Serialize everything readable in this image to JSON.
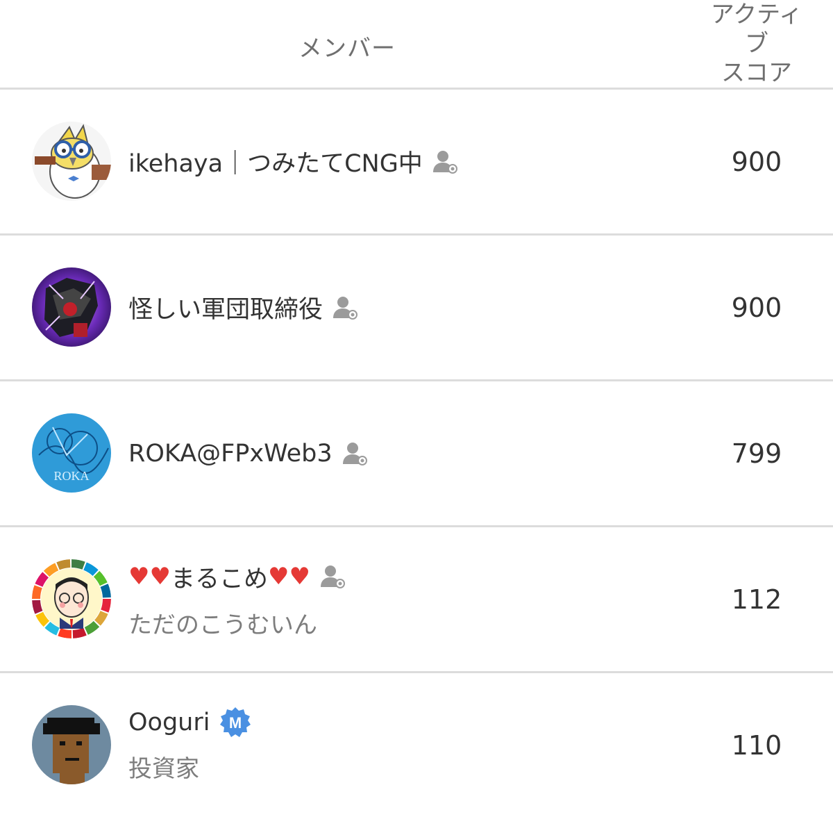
{
  "header": {
    "member_label": "メンバー",
    "score_label_1": "アクティ",
    "score_label_2": "ブ",
    "score_label_3": "スコア"
  },
  "rows": [
    {
      "name": "ikehaya｜つみたてCNG中",
      "sub": "",
      "score": "900",
      "badge": "member-award-icon"
    },
    {
      "name": "怪しい軍団取締役",
      "sub": "",
      "score": "900",
      "badge": "member-award-icon"
    },
    {
      "name": "ROKA@FPxWeb3",
      "sub": "",
      "score": "799",
      "badge": "member-award-icon"
    },
    {
      "name_prefix": "♥♥",
      "name": "まるこめ",
      "name_suffix": "♥♥",
      "sub": "ただのこうむいん",
      "score": "112",
      "badge": "member-award-icon"
    },
    {
      "name": "Ooguri",
      "sub": "投資家",
      "score": "110",
      "badge": "m-verified-badge-icon"
    }
  ],
  "avatar_3_text": "ROKA",
  "colors": {
    "badge_grey": "#9b9b9b",
    "verified_blue": "#4a90e2",
    "divider": "#dcdcdc"
  }
}
